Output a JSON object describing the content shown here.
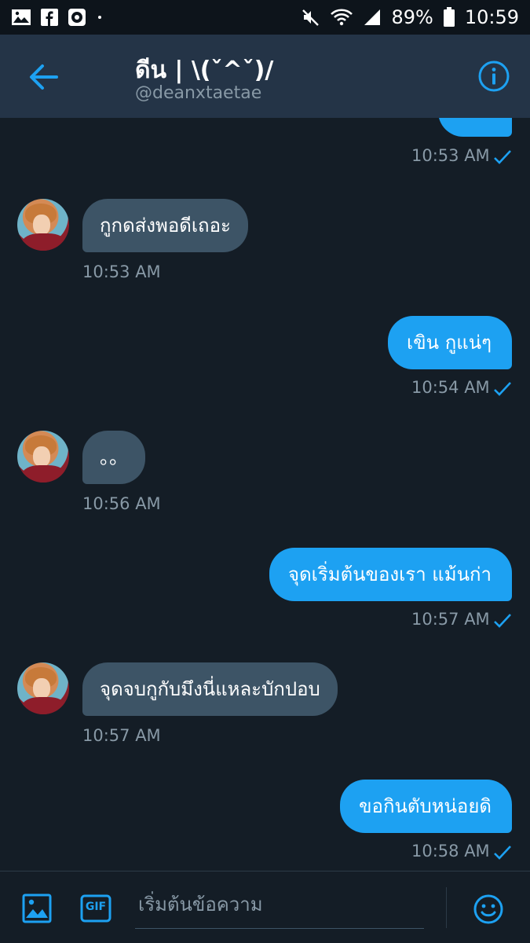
{
  "status_bar": {
    "battery": "89%",
    "time": "10:59",
    "left_icons": [
      "image-icon",
      "facebook-icon",
      "music-icon",
      "dot-icon"
    ],
    "right_icons": [
      "mute-icon",
      "wifi-icon",
      "signal-icon",
      "battery-icon"
    ]
  },
  "header": {
    "name": "ดีน | \\(ˇ^ˇ)/",
    "handle": "@deanxtaetae",
    "back_icon": "arrow-left-icon",
    "info_icon": "info-icon"
  },
  "messages": [
    {
      "dir": "out",
      "text": "",
      "time": "10:53 AM",
      "read": true
    },
    {
      "dir": "in",
      "text": "กูกดส่งพอดีเถอะ",
      "time": "10:53 AM"
    },
    {
      "dir": "out",
      "text": "เขิน กูแน่ๆ",
      "time": "10:54 AM",
      "read": true
    },
    {
      "dir": "in",
      "text": "。。",
      "time": "10:56 AM"
    },
    {
      "dir": "out",
      "text": "จุดเริ่มต้นของเรา แม้นก่า",
      "time": "10:57 AM",
      "read": true
    },
    {
      "dir": "in",
      "text": "จุดจบกูกับมึงนี่แหละบักปอบ",
      "time": "10:57 AM"
    },
    {
      "dir": "out",
      "text": "ขอกินตับหน่อยดิ",
      "time": "10:58 AM",
      "read": true
    }
  ],
  "composer": {
    "placeholder": "เริ่มต้นข้อความ",
    "value": "",
    "gif_label": "GIF",
    "media_icon": "image-icon",
    "emoji_icon": "smiley-icon"
  },
  "colors": {
    "accent": "#1da1f2",
    "background": "#141d26",
    "header": "#243447",
    "incoming_bubble": "#3d5466",
    "muted_text": "#8899a6"
  }
}
